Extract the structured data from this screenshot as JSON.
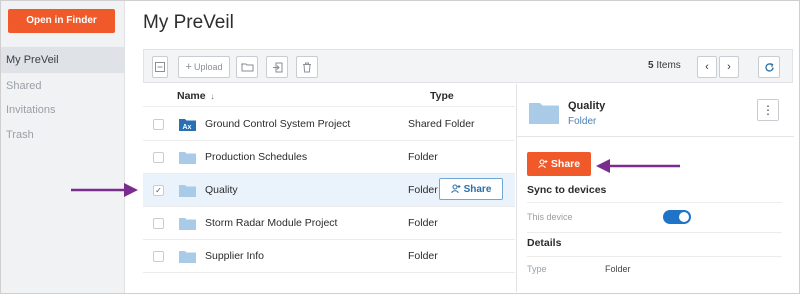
{
  "sidebar": {
    "open_finder_label": "Open in Finder",
    "items": [
      {
        "label": "My PreVeil",
        "active": true
      },
      {
        "label": "Shared",
        "active": false
      },
      {
        "label": "Invitations",
        "active": false
      },
      {
        "label": "Trash",
        "active": false
      }
    ]
  },
  "header": {
    "title": "My PreVeil"
  },
  "toolbar": {
    "upload_label": "Upload",
    "items_count": "5",
    "items_label": "Items"
  },
  "list": {
    "columns": {
      "name": "Name",
      "sort_indicator": "↓",
      "type": "Type"
    },
    "rows": [
      {
        "name": "Ground Control System Project",
        "type": "Shared Folder",
        "icon": "shared-folder-icon",
        "selected": false
      },
      {
        "name": "Production Schedules",
        "type": "Folder",
        "icon": "folder-icon",
        "selected": false
      },
      {
        "name": "Quality",
        "type": "Folder",
        "icon": "folder-icon",
        "selected": true
      },
      {
        "name": "Storm Radar Module Project",
        "type": "Folder",
        "icon": "folder-icon",
        "selected": false
      },
      {
        "name": "Supplier Info",
        "type": "Folder",
        "icon": "folder-icon",
        "selected": false
      }
    ],
    "row_share_label": "Share"
  },
  "details": {
    "name": "Quality",
    "type": "Folder",
    "share_label": "Share",
    "sync_heading": "Sync to devices",
    "this_device_label": "This device",
    "sync_enabled": true,
    "details_heading": "Details",
    "type_label": "Type",
    "type_value": "Folder"
  },
  "colors": {
    "accent": "#f0592a",
    "folder": "#a9cbe8",
    "annotation_arrow": "#7b2d8e",
    "toggle_on": "#1f74c7"
  }
}
